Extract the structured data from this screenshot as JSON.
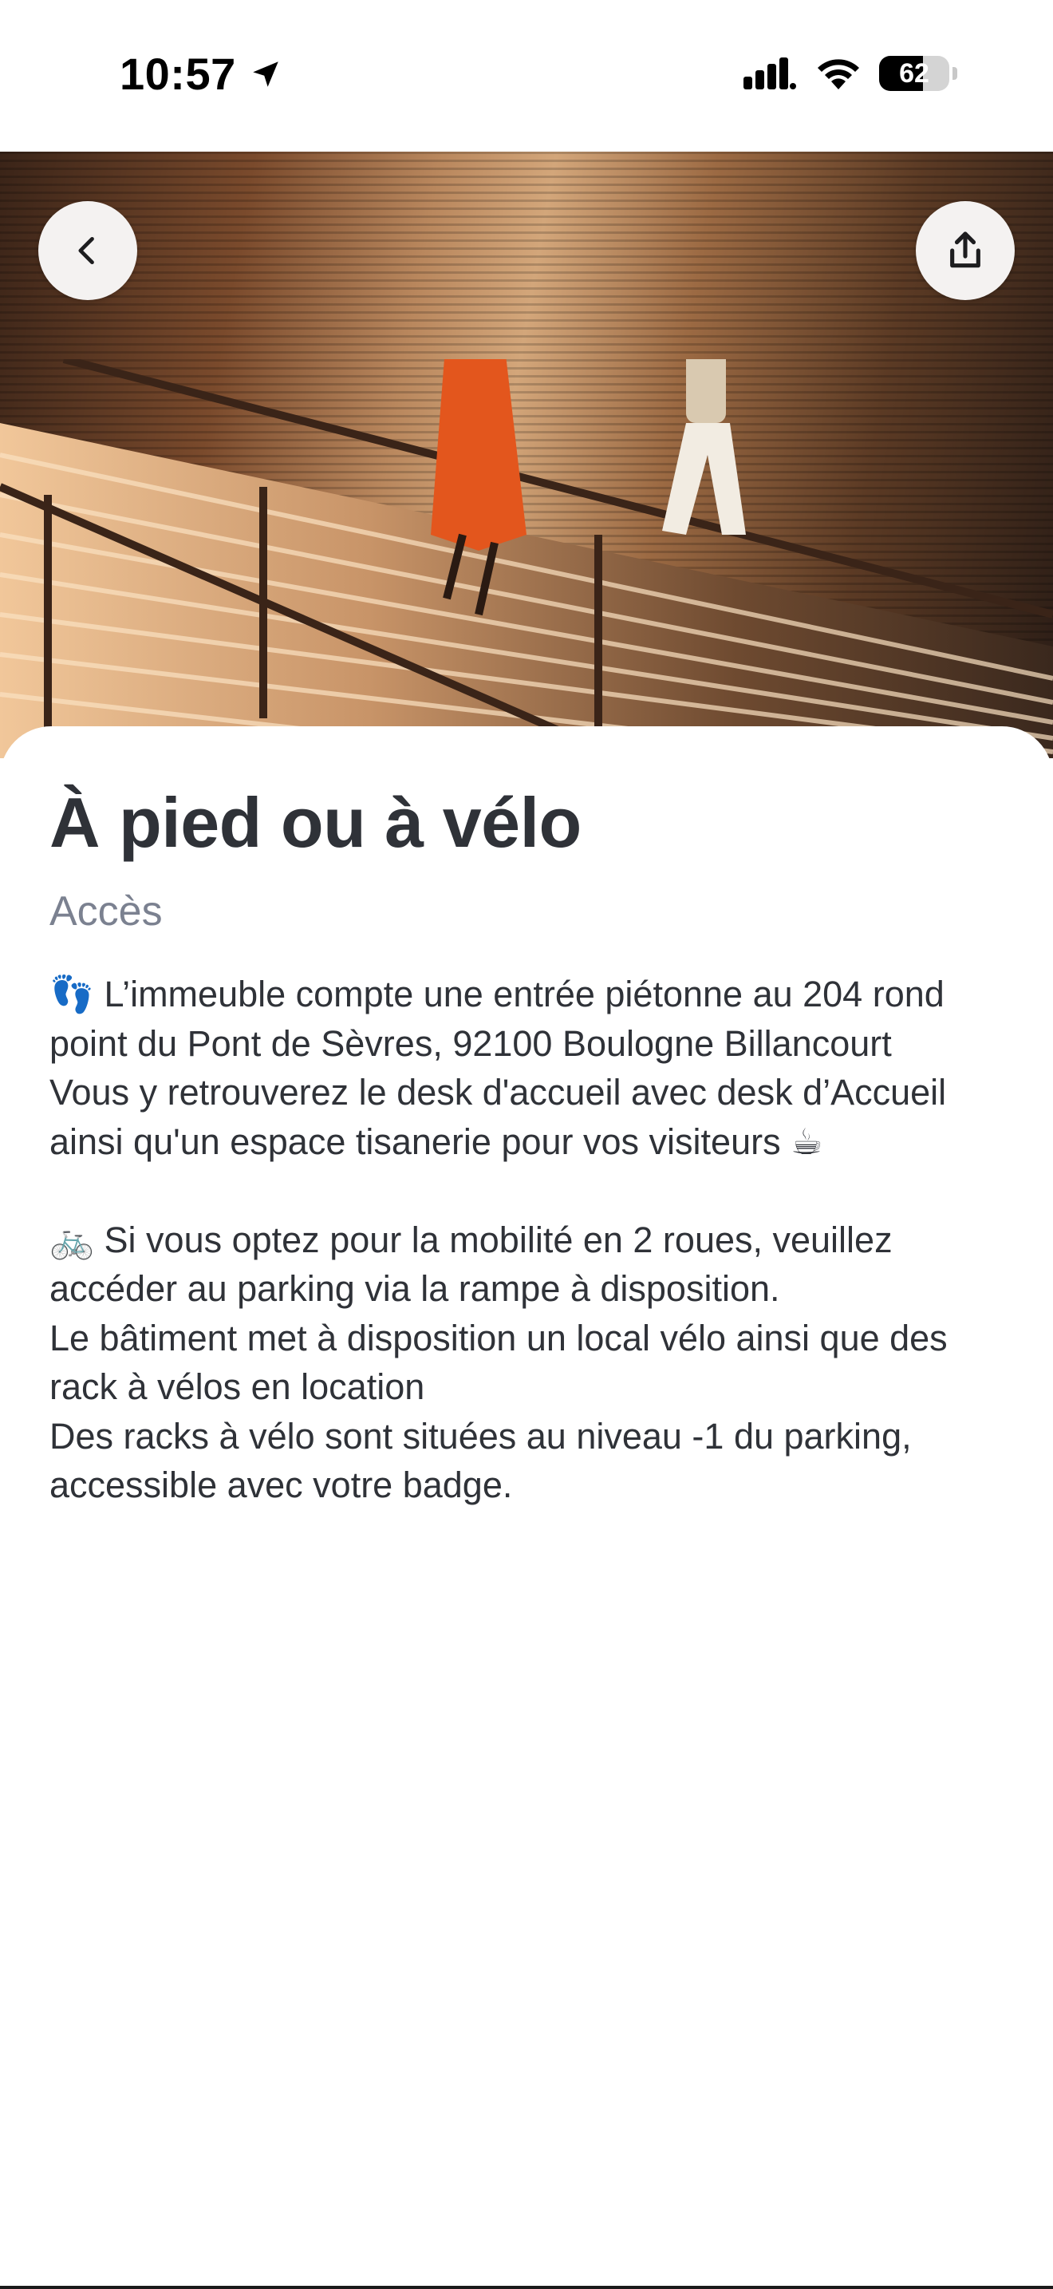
{
  "status_bar": {
    "time": "10:57",
    "battery_level": "62",
    "battery_fraction": 0.62
  },
  "header": {
    "back_icon": "chevron-left-icon",
    "share_icon": "share-icon"
  },
  "content": {
    "title": "À pied ou à vélo",
    "subtitle": "Accès",
    "paragraph1": {
      "line1": "👣 L’immeuble compte une entrée piétonne au 204 rond point du Pont de Sèvres, 92100 Boulogne Billancourt",
      "line2": "Vous y retrouverez le desk d'accueil avec desk d’Accueil ainsi qu'un espace tisanerie pour vos visiteurs ☕"
    },
    "paragraph2": {
      "line1": "🚲 Si vous optez pour la mobilité en 2 roues, veuillez accéder au parking via la rampe à disposition.",
      "line2": "Le bâtiment met à disposition un local vélo ainsi que des rack à vélos en location",
      "line3": "Des racks à vélo sont situées au niveau -1 du parking, accessible avec votre badge."
    }
  },
  "colors": {
    "title": "#2f3238",
    "subtitle": "#7b8190",
    "body": "#2f3238",
    "button_bg": "#f4f2f1"
  }
}
